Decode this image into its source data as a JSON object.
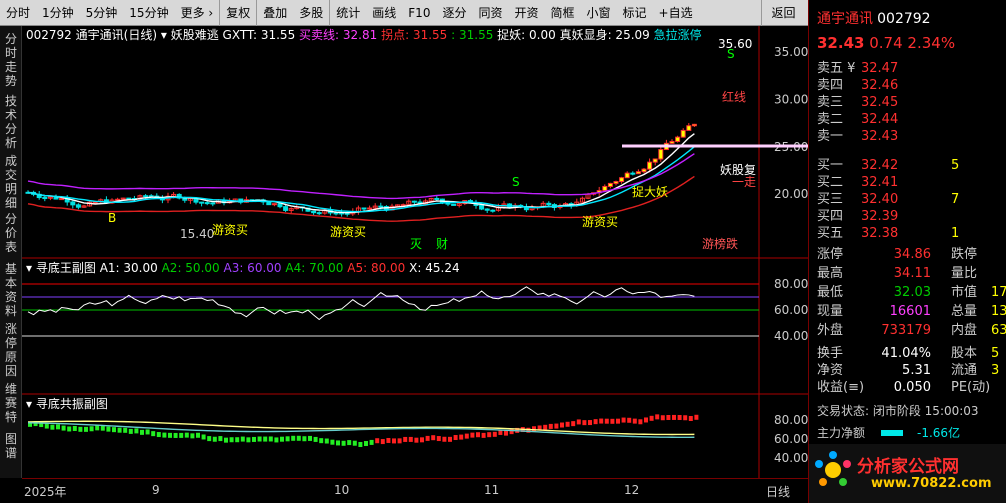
{
  "toolbar": {
    "items": [
      "分时",
      "1分钟",
      "5分钟",
      "15分钟",
      "更多 ›",
      "复权",
      "叠加",
      "多股",
      "统计",
      "画线",
      "F10",
      "逐分",
      "同资",
      "开资",
      "简框",
      "小窗",
      "标记",
      "+自选"
    ],
    "back": "返回"
  },
  "leftnav": [
    "分时走势",
    "技术分析",
    "成交明细",
    "分价表",
    "基本资料",
    "涨停原因",
    "维赛特",
    "图谱"
  ],
  "main_info": {
    "code": "002792",
    "name": "通宇通讯(日线)",
    "indicator": "妖股难逃",
    "gxtt": "GXTT: 31.55",
    "maimai": "买卖线: 32.81",
    "guaidian": "拐点: 31.55",
    "val3": ": 31.55",
    "zhuoyao": "捉妖: 0.00",
    "zhenyao": "真妖显身: 25.09",
    "jila": "急拉涨停"
  },
  "sub1": {
    "title": "寻底王副图",
    "a1": "A1: 30.00",
    "a2": "A2: 50.00",
    "a3": "A3: 60.00",
    "a4": "A4: 70.00",
    "a5": "A5: 80.00",
    "x": "X: 45.24"
  },
  "sub2": {
    "title": "寻底共振副图"
  },
  "chart_data": {
    "type": "candlestick",
    "xlabels": [
      "2025年",
      "9",
      "10",
      "11",
      "12",
      "日线"
    ],
    "price_axis": [
      35,
      30,
      25,
      20
    ],
    "osc_axis": [
      80,
      60,
      40
    ],
    "res_axis": [
      80,
      60,
      40
    ],
    "annotations": [
      "35.60",
      "15.40",
      "游资买",
      "游资买",
      "游资买",
      "灭",
      "财",
      "游榜跌",
      "妖股复",
      "捉大妖",
      "一走",
      "红线",
      "S",
      "S",
      "B"
    ],
    "osc_x": 45.24
  },
  "quote": {
    "name": "通宇通讯",
    "code": "002792",
    "price": "32.43",
    "change": "0.74",
    "pct": "2.34%",
    "asks": [
      {
        "l": "卖五 ¥",
        "p": "32.47"
      },
      {
        "l": "卖四",
        "p": "32.46"
      },
      {
        "l": "卖三",
        "p": "32.45"
      },
      {
        "l": "卖二",
        "p": "32.44"
      },
      {
        "l": "卖一",
        "p": "32.43"
      }
    ],
    "bids": [
      {
        "l": "买一",
        "p": "32.42"
      },
      {
        "l": "买二",
        "p": "32.41"
      },
      {
        "l": "买三",
        "p": "32.40"
      },
      {
        "l": "买四",
        "p": "32.39"
      },
      {
        "l": "买五",
        "p": "32.38"
      }
    ],
    "bidvols": [
      "5",
      "",
      "7",
      "",
      "1"
    ],
    "stats": [
      {
        "l": "涨停",
        "v": "34.86",
        "l2": "跌停",
        "v2": ""
      },
      {
        "l": "最高",
        "v": "34.11",
        "l2": "量比",
        "v2": ""
      },
      {
        "l": "最低",
        "v": "32.03",
        "l2": "市值",
        "v2": "17"
      },
      {
        "l": "现量",
        "v": "16601",
        "l2": "总量",
        "v2": "13"
      },
      {
        "l": "外盘",
        "v": "733179",
        "l2": "内盘",
        "v2": "63"
      }
    ],
    "stats2": [
      {
        "l": "换手",
        "v": "41.04%",
        "l2": "股本",
        "v2": "5"
      },
      {
        "l": "净资",
        "v": "5.31",
        "l2": "流通",
        "v2": "3"
      },
      {
        "l": "收益(≡)",
        "v": "0.050",
        "l2": "PE(动)",
        "v2": ""
      }
    ],
    "trade_state": "交易状态: 闭市阶段 15:00:03",
    "net_flow_label": "主力净额",
    "net_flow": "-1.66亿",
    "logo": "分析家公式网",
    "logo_url": "www.70822.com"
  }
}
